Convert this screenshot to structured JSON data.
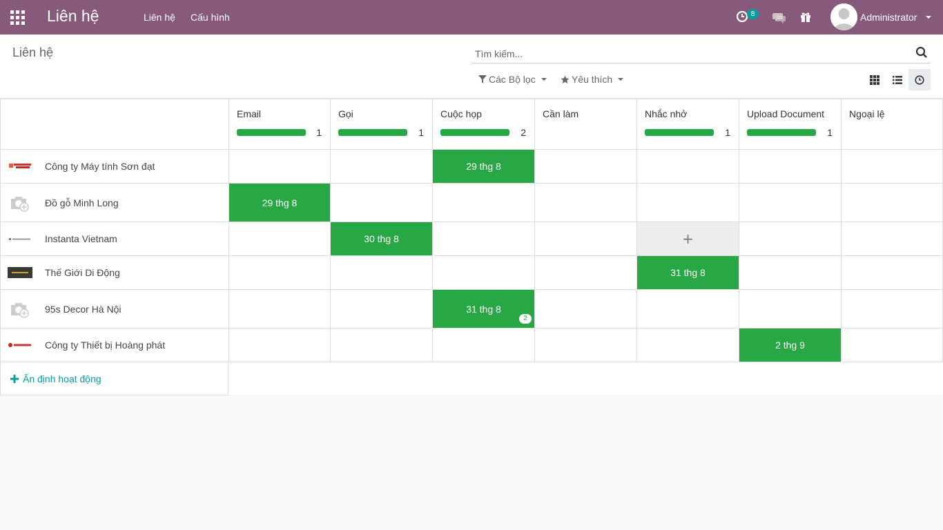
{
  "navbar": {
    "brand": "Liên hệ",
    "menu": [
      "Liên hệ",
      "Cấu hình"
    ],
    "activity_badge": "8",
    "user": "Administrator",
    "bg_color": "#875a7b"
  },
  "control": {
    "breadcrumb": "Liên hệ",
    "search_placeholder": "Tìm kiếm...",
    "filters_label": "Các Bộ lọc",
    "favorites_label": "Yêu thích"
  },
  "columns": [
    {
      "title": "Email",
      "count": "1",
      "progress": 1.0
    },
    {
      "title": "Gọi",
      "count": "1",
      "progress": 1.0
    },
    {
      "title": "Cuộc họp",
      "count": "2",
      "progress": 1.0
    },
    {
      "title": "Cần làm",
      "count": "",
      "progress": 0
    },
    {
      "title": "Nhắc nhở",
      "count": "1",
      "progress": 1.0
    },
    {
      "title": "Upload Document",
      "count": "1",
      "progress": 1.0
    },
    {
      "title": "Ngoại lệ",
      "count": "",
      "progress": 0
    }
  ],
  "rows": [
    {
      "name": "Công ty Máy tính Sơn đạt",
      "logo": "sondat-logo",
      "cells": [
        "",
        "",
        "29 thg 8",
        "",
        "",
        "",
        ""
      ]
    },
    {
      "name": "Đồ gỗ Minh Long",
      "logo": "camera-placeholder-icon",
      "cells": [
        "29 thg 8",
        "",
        "",
        "",
        "",
        "",
        ""
      ]
    },
    {
      "name": "Instanta Vietnam",
      "logo": "your-logo",
      "cells": [
        "",
        "30 thg 8",
        "",
        "",
        "+",
        "",
        ""
      ]
    },
    {
      "name": "Thế Giới Di Động",
      "logo": "tgdd-logo",
      "cells": [
        "",
        "",
        "",
        "",
        "31 thg 8",
        "",
        ""
      ]
    },
    {
      "name": "95s Decor Hà Nội",
      "logo": "camera-placeholder-icon",
      "cells": [
        "",
        "",
        "31 thg 8",
        "",
        "",
        "",
        ""
      ],
      "badge": {
        "col": 2,
        "value": "2"
      }
    },
    {
      "name": "Công ty Thiết bị Hoàng phát",
      "logo": "hoangphat-logo",
      "cells": [
        "",
        "",
        "",
        "",
        "",
        "2 thg 9",
        ""
      ]
    }
  ],
  "footer": {
    "add_label": "Ấn định hoạt động"
  },
  "colors": {
    "activity": "#28a745",
    "accent": "#00a09d"
  }
}
